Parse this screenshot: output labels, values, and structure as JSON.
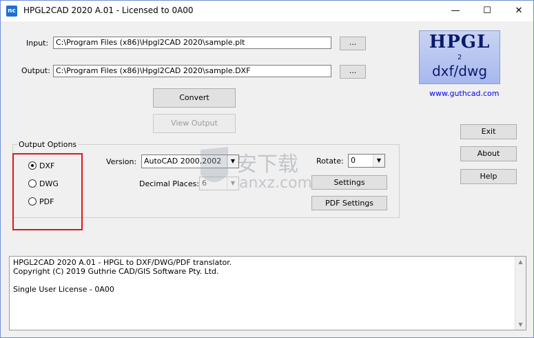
{
  "window": {
    "app_icon_text": "nc",
    "title": "HPGL2CAD 2020 A.01 - Licensed to 0A00",
    "controls": {
      "minimize": "—",
      "maximize": "☐",
      "close": "✕"
    }
  },
  "io": {
    "input_label": "Input:",
    "input_value": "C:\\Program Files (x86)\\Hpgl2CAD 2020\\sample.plt",
    "input_browse": "...",
    "output_label": "Output:",
    "output_value": "C:\\Program Files (x86)\\Hpgl2CAD 2020\\sample.DXF",
    "output_browse": "..."
  },
  "actions": {
    "convert": "Convert",
    "view_output": "View Output",
    "exit": "Exit",
    "about": "About",
    "help": "Help"
  },
  "logo": {
    "line1": "HPGL",
    "line2": "2",
    "line3": "dxf/dwg",
    "url": "www.guthcad.com"
  },
  "options": {
    "title": "Output Options",
    "formats": [
      {
        "label": "DXF",
        "selected": true
      },
      {
        "label": "DWG",
        "selected": false
      },
      {
        "label": "PDF",
        "selected": false
      }
    ],
    "version_label": "Version:",
    "version_value": "AutoCAD 2000,2002",
    "decimal_label": "Decimal Places:",
    "decimal_value": "6",
    "rotate_label": "Rotate:",
    "rotate_value": "0",
    "settings": "Settings",
    "pdf_settings": "PDF Settings"
  },
  "status": {
    "lines": [
      "HPGL2CAD 2020 A.01 - HPGL to DXF/DWG/PDF translator.",
      "Copyright (C) 2019 Guthrie CAD/GIS Software Pty. Ltd.",
      "",
      "Single User License - 0A00"
    ]
  },
  "watermark": {
    "text_cn": "安下载",
    "text_en": "anxz.com"
  },
  "colors": {
    "highlight_box": "#e0151b",
    "link": "#0000ee",
    "window_bg": "#f0f0f0"
  }
}
